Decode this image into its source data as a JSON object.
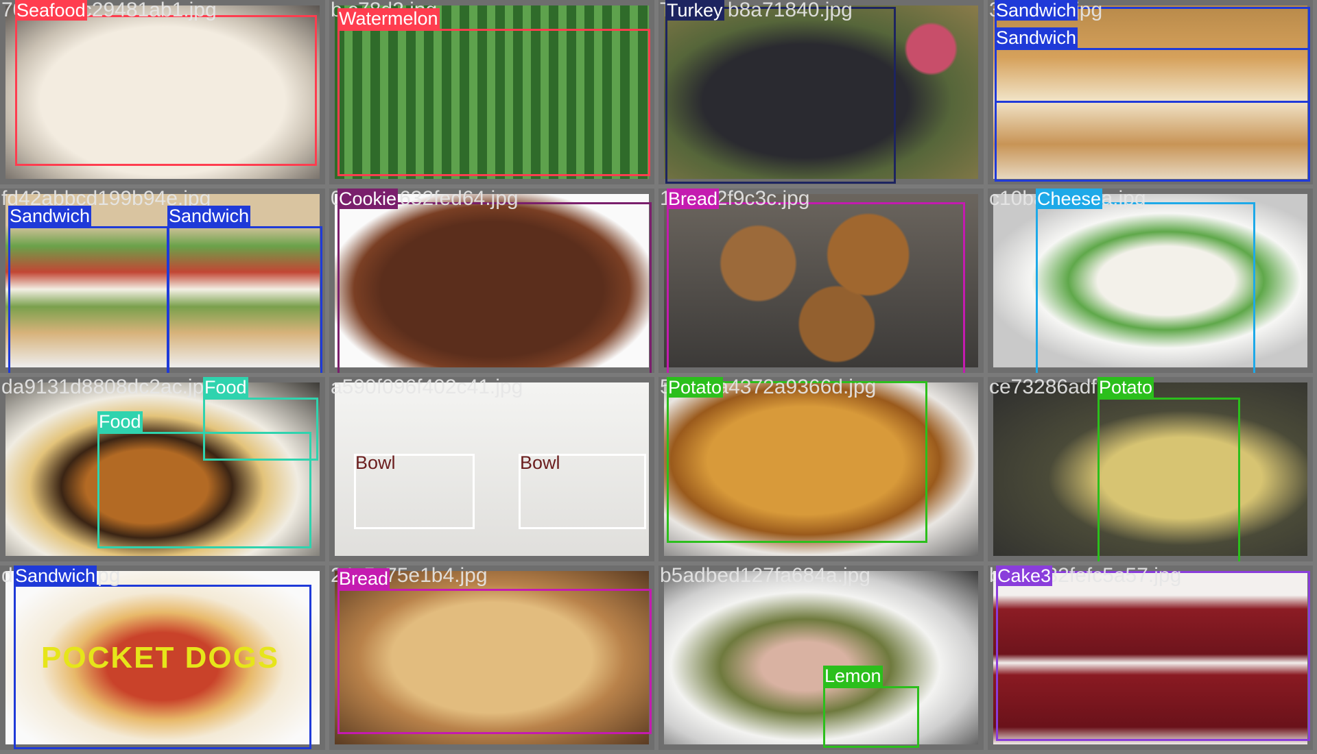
{
  "tiles": [
    {
      "name": "tile-seafood",
      "bg": "bg-seafood",
      "filename": "708ab62c29481ab1.jpg",
      "boxes": [
        {
          "label": "Seafood",
          "color": "#ff3d4f"
        }
      ]
    },
    {
      "name": "tile-watermelon",
      "bg": "bg-water",
      "filename": "b      c78d2.jpg",
      "boxes": [
        {
          "label": "Watermelon",
          "color": "#ff3d4f"
        }
      ]
    },
    {
      "name": "tile-turkey",
      "bg": "bg-turkey",
      "filename": "Turkey  b8a71840.jpg",
      "boxes": [
        {
          "label": "Turkey",
          "color": "#1d2460"
        }
      ]
    },
    {
      "name": "tile-sandwich-closeup",
      "bg": "bg-sand1",
      "filename": "3e337e7.jpg",
      "boxes": [
        {
          "label": "Sandwich",
          "color": "#1f3ad8"
        },
        {
          "label": "Sandwich",
          "color": "#1f3ad8"
        }
      ]
    },
    {
      "name": "tile-sandwich-halves",
      "bg": "bg-sand2",
      "filename": "fd42abbcd199b94e.jpg",
      "boxes": [
        {
          "label": "Sandwich",
          "color": "#1f3ad8"
        },
        {
          "label": "Sandwich",
          "color": "#1f3ad8"
        }
      ]
    },
    {
      "name": "tile-cookie",
      "bg": "bg-cookie",
      "filename": "0fb94f4632fed64.jpg",
      "boxes": [
        {
          "label": "Cookie",
          "color": "#7a1f6c"
        }
      ]
    },
    {
      "name": "tile-bread-loaves",
      "bg": "bg-bread",
      "filename": "19c842f9c3c.jpg",
      "boxes": [
        {
          "label": "Bread",
          "color": "#c41bb0"
        }
      ]
    },
    {
      "name": "tile-cheese",
      "bg": "bg-cheese",
      "filename": "c10bac5367a.jpg",
      "boxes": [
        {
          "label": "Cheese",
          "color": "#1ea9e8"
        }
      ]
    },
    {
      "name": "tile-burger",
      "bg": "bg-burger",
      "filename": "da9131d8808dc2ac.jpg",
      "boxes": [
        {
          "label": "Food",
          "color": "#2fd3ae"
        },
        {
          "label": "Food",
          "color": "#2fd3ae"
        }
      ]
    },
    {
      "name": "tile-bowls",
      "bg": "bg-bowl",
      "filename": "a590f096f402c41.jpg",
      "boxes": [
        {
          "label": "Bowl",
          "color": "#ffffff",
          "text": "#6b1e1e"
        },
        {
          "label": "Bowl",
          "color": "#ffffff",
          "text": "#6b1e1e"
        }
      ]
    },
    {
      "name": "tile-fries",
      "bg": "bg-fries",
      "filename": "59091a4372a9366d.jpg",
      "boxes": [
        {
          "label": "Potato",
          "color": "#2bbf1c"
        }
      ]
    },
    {
      "name": "tile-potatoes",
      "bg": "bg-potato",
      "filename": "ce73286adf      .jpg",
      "boxes": [
        {
          "label": "Potato",
          "color": "#2bbf1c"
        }
      ]
    },
    {
      "name": "tile-hotdog",
      "bg": "bg-hotdog",
      "filename": "d        a22a53.jpg",
      "boxes": [
        {
          "label": "Sandwich",
          "color": "#1f3ad8"
        }
      ]
    },
    {
      "name": "tile-flatbread",
      "bg": "bg-flat",
      "filename": "24c5c75e1b4.jpg",
      "boxes": [
        {
          "label": "Bread",
          "color": "#c41bb0"
        }
      ]
    },
    {
      "name": "tile-lemon-plate",
      "bg": "bg-plate",
      "filename": "b5adbed127fa684a.jpg",
      "boxes": [
        {
          "label": "Lemon",
          "color": "#2bbf1c"
        }
      ]
    },
    {
      "name": "tile-cake",
      "bg": "bg-cake",
      "filename": "b287732fefc5a57.jpg",
      "boxes": [
        {
          "label": "Cake3",
          "color": "#8a3ddb"
        }
      ]
    }
  ],
  "hotdog_text": "POCKET DOGS"
}
